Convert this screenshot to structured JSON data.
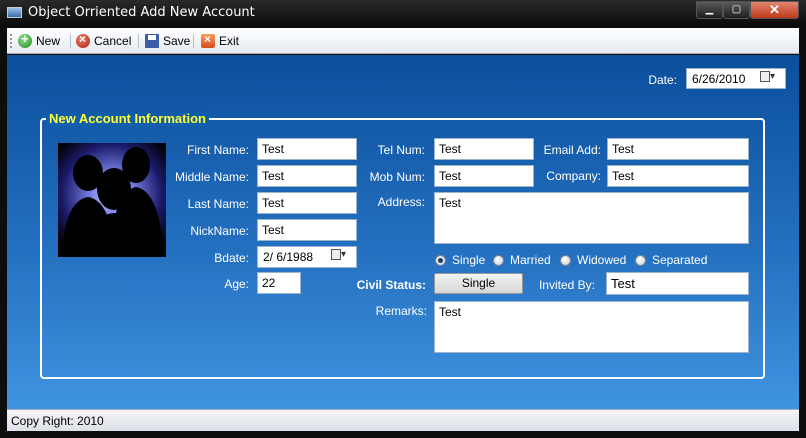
{
  "window": {
    "title": "Object Orriented Add New Account"
  },
  "toolbar": {
    "new": "New",
    "cancel": "Cancel",
    "save": "Save",
    "exit": "Exit"
  },
  "header": {
    "date_label": "Date:",
    "date_value": "6/26/2010"
  },
  "group": {
    "title": "New Account Information"
  },
  "form": {
    "first_name_label": "First Name:",
    "first_name": "Test",
    "middle_name_label": "Middle Name:",
    "middle_name": "Test",
    "last_name_label": "Last Name:",
    "last_name": "Test",
    "nickname_label": "NickName:",
    "nickname": "Test",
    "bdate_label": "Bdate:",
    "bdate": "2/ 6/1988",
    "age_label": "Age:",
    "age": "22",
    "tel_label": "Tel Num:",
    "tel": "Test",
    "mob_label": "Mob Num:",
    "mob": "Test",
    "address_label": "Address:",
    "address": "Test",
    "email_label": "Email Add:",
    "email": "Test",
    "company_label": "Company:",
    "company": "Test",
    "civil_status_label": "Civil Status:",
    "civil_status_value": "Single",
    "civil_options": [
      "Single",
      "Married",
      "Widowed",
      "Separated"
    ],
    "invited_by_label": "Invited By:",
    "invited_by": "Test",
    "remarks_label": "Remarks:",
    "remarks": "Test"
  },
  "statusbar": {
    "text": "Copy Right: 2010"
  },
  "colors": {
    "panel_top": "#0b4f9c",
    "panel_bottom": "#3f94e0",
    "group_title": "#ffff33"
  }
}
